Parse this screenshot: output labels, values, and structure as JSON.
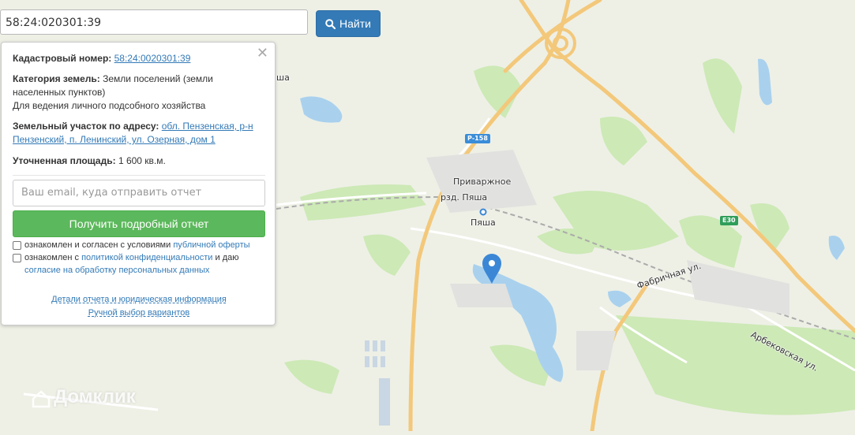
{
  "search": {
    "value": "58:24:020301:39",
    "button_label": "Найти"
  },
  "panel": {
    "cadastral_label": "Кадастровый номер:",
    "cadastral_value": "58:24:0020301:39",
    "category_label": "Категория земель:",
    "category_value": "Земли поселений (земли населенных пунктов)",
    "usage": "Для ведения личного подсобного хозяйства",
    "address_label": "Земельный участок по адресу:",
    "address_value": "обл. Пензенская, р-н Пензенский, п. Ленинский, ул. Озерная, дом 1",
    "area_label": "Уточненная площадь:",
    "area_value": "1 600 кв.м.",
    "email_placeholder": "Ваш email, куда отправить отчет",
    "report_button": "Получить подробный отчет",
    "consent1_text": "ознакомлен и согласен с условиями",
    "consent1_link": "публичной оферты",
    "consent2_text": "ознакомлен с",
    "consent2_link": "политикой конфиденциальности",
    "consent2_text2": "и даю",
    "consent2_link2": "согласие на обработку персональных данных",
    "footer_link1": "Детали отчета и юридическая информация",
    "footer_link2": "Ручной выбор вариантов"
  },
  "map": {
    "labels": {
      "privrazhnoe": "Приваржное",
      "rzd_pyasha": "рзд. Пяша",
      "pyasha": "Пяша",
      "fabrichnaya": "Фабричная ул.",
      "arbekovskaya": "Арбековская ул.",
      "sha_fragment": "ша"
    },
    "road_badges": {
      "r158": "Р-158",
      "e30": "E30"
    },
    "watermark": "Домклик"
  },
  "colors": {
    "primary_button": "#337ab7",
    "report_button": "#5cb85c",
    "road_major": "#f3c87a",
    "water": "#a9d1ee",
    "forest": "#cde9b6",
    "marker": "#3b87d6"
  }
}
